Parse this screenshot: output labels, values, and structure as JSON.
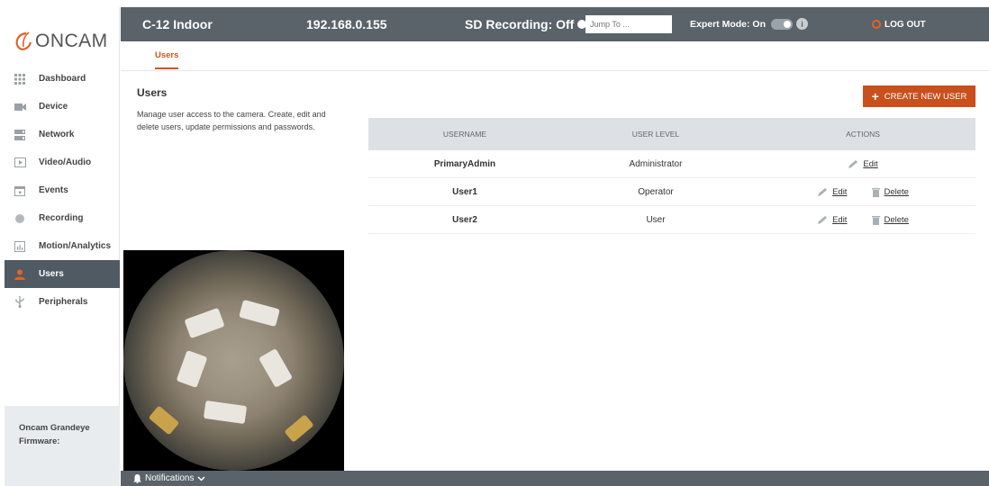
{
  "brand": {
    "name": "ONCAM",
    "accent": "#c9501c"
  },
  "topbar": {
    "camera_name": "C-12 Indoor",
    "ip_address": "192.168.0.155",
    "sd_recording": "SD Recording: Off",
    "jump_placeholder": "Jump To ...",
    "expert_mode": "Expert Mode: On",
    "logout": "LOG OUT"
  },
  "sidebar": {
    "items": [
      {
        "label": "Dashboard",
        "icon": "grid-icon"
      },
      {
        "label": "Device",
        "icon": "camera-icon"
      },
      {
        "label": "Network",
        "icon": "server-icon"
      },
      {
        "label": "Video/Audio",
        "icon": "play-icon"
      },
      {
        "label": "Events",
        "icon": "calendar-icon"
      },
      {
        "label": "Recording",
        "icon": "record-icon"
      },
      {
        "label": "Motion/Analytics",
        "icon": "chart-icon"
      },
      {
        "label": "Users",
        "icon": "user-icon",
        "active": true
      },
      {
        "label": "Peripherals",
        "icon": "usb-icon"
      }
    ],
    "firmware_line1": "Oncam Grandeye",
    "firmware_line2": "Firmware:"
  },
  "tabs": {
    "users": "Users"
  },
  "main": {
    "heading": "Users",
    "description": "Manage user access to the camera. Create, edit and delete users, update permissions and passwords.",
    "create_button": "CREATE NEW USER"
  },
  "table": {
    "headers": {
      "username": "USERNAME",
      "level": "USER LEVEL",
      "actions": "ACTIONS"
    },
    "rows": [
      {
        "username": "PrimaryAdmin",
        "level": "Administrator",
        "edit": "Edit"
      },
      {
        "username": "User1",
        "level": "Operator",
        "edit": "Edit",
        "delete": "Delete"
      },
      {
        "username": "User2",
        "level": "User",
        "edit": "Edit",
        "delete": "Delete"
      }
    ]
  },
  "footer": {
    "notifications": "Notifications"
  }
}
